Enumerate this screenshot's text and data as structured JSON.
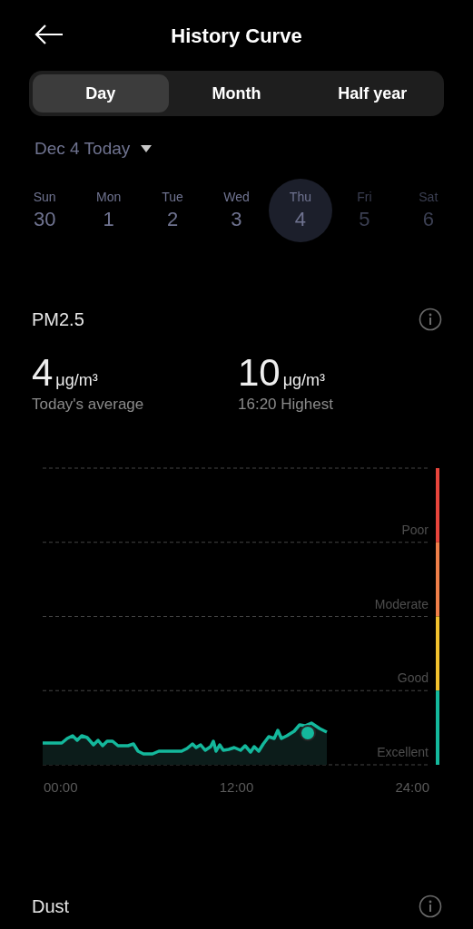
{
  "header": {
    "title": "History Curve"
  },
  "tabs": [
    {
      "label": "Day",
      "selected": true
    },
    {
      "label": "Month",
      "selected": false
    },
    {
      "label": "Half year",
      "selected": false
    }
  ],
  "date_picker": {
    "label": "Dec 4 Today"
  },
  "week": [
    {
      "weekday": "Sun",
      "day": "30",
      "selected": false,
      "disabled": false
    },
    {
      "weekday": "Mon",
      "day": "1",
      "selected": false,
      "disabled": false
    },
    {
      "weekday": "Tue",
      "day": "2",
      "selected": false,
      "disabled": false
    },
    {
      "weekday": "Wed",
      "day": "3",
      "selected": false,
      "disabled": false
    },
    {
      "weekday": "Thu",
      "day": "4",
      "selected": true,
      "disabled": false
    },
    {
      "weekday": "Fri",
      "day": "5",
      "selected": false,
      "disabled": true
    },
    {
      "weekday": "Sat",
      "day": "6",
      "selected": false,
      "disabled": true
    }
  ],
  "pm25": {
    "title": "PM2.5",
    "stats": [
      {
        "value": "4",
        "unit": "μg/m³",
        "caption": "Today's average"
      },
      {
        "value": "10",
        "unit": "μg/m³",
        "caption": "16:20 Highest"
      }
    ],
    "chart": {
      "bands": [
        {
          "label": "Poor",
          "color": "#e8453c"
        },
        {
          "label": "Moderate",
          "color": "#f07f4a"
        },
        {
          "label": "Good",
          "color": "#f2c12e"
        },
        {
          "label": "Excellent",
          "color": "#14b89c"
        }
      ],
      "x_labels": [
        "00:00",
        "12:00",
        "24:00"
      ]
    }
  },
  "dust": {
    "title": "Dust"
  }
}
